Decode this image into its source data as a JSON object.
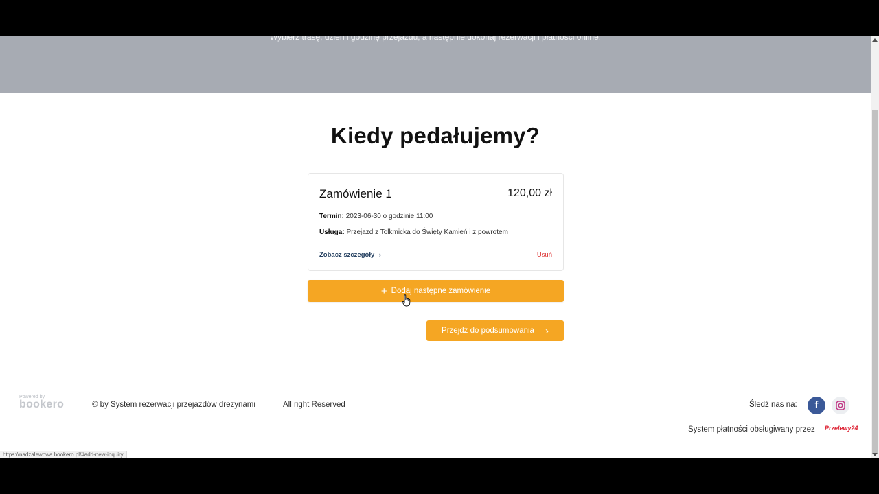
{
  "hero": {
    "subtitle": "Wybierz trasę, dzień i godzinę przejazdu, a następnie dokonaj rezerwacji i płatności online."
  },
  "main": {
    "title": "Kiedy pedałujemy?",
    "order": {
      "title": "Zamówienie 1",
      "price": "120,00 zł",
      "term_label": "Termin:",
      "term_value": "2023-06-30 o godzinie 11:00",
      "service_label": "Usługa:",
      "service_value": "Przejazd z Tolkmicka do Święty Kamień i z powrotem",
      "details_link": "Zobacz szczegóły",
      "details_icon": "chevron-right-icon",
      "remove_link": "Usuń"
    },
    "add_button": "Dodaj następne zamówienie",
    "add_icon": "plus-icon",
    "next_button": "Przejdź do podsumowania",
    "next_icon": "chevron-right-icon"
  },
  "footer": {
    "powered_by": "Powered by",
    "logo": "bookero",
    "copyright": "© by System rezerwacji przejazdów drezynami",
    "rights": "All right Reserved",
    "follow_label": "Śledź nas na:",
    "facebook_icon": "facebook-icon",
    "instagram_icon": "instagram-icon",
    "payment_label": "System płatności obsługiwany przez",
    "payment_logo": "Przelewy24"
  },
  "status_bar": {
    "url": "https://nadzalewowa.bookero.pl/#add-new-inquiry"
  },
  "colors": {
    "accent": "#f5a623",
    "hero_bg": "#a7abb3",
    "link": "#1f3b5c",
    "danger": "#dd3333"
  }
}
